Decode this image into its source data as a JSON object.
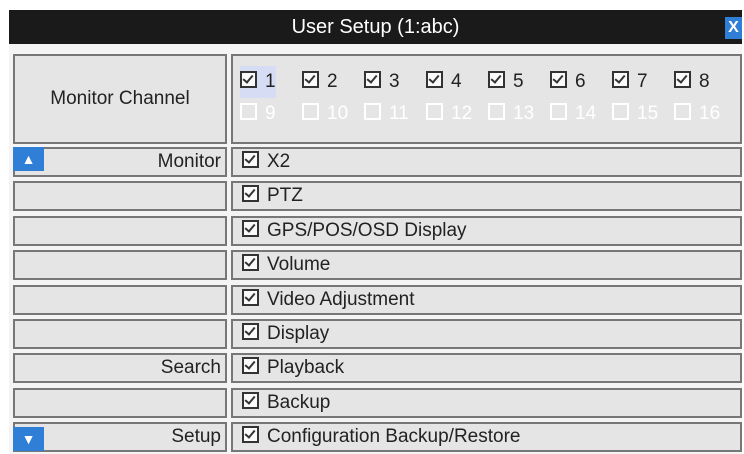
{
  "title": "User Setup (1:abc)",
  "close_glyph": "X",
  "monitor_channel_label": "Monitor Channel",
  "channels": [
    {
      "label": "1",
      "checked": true,
      "enabled": true
    },
    {
      "label": "2",
      "checked": true,
      "enabled": true
    },
    {
      "label": "3",
      "checked": true,
      "enabled": true
    },
    {
      "label": "4",
      "checked": true,
      "enabled": true
    },
    {
      "label": "5",
      "checked": true,
      "enabled": true
    },
    {
      "label": "6",
      "checked": true,
      "enabled": true
    },
    {
      "label": "7",
      "checked": true,
      "enabled": true
    },
    {
      "label": "8",
      "checked": true,
      "enabled": true
    },
    {
      "label": "9",
      "checked": false,
      "enabled": false
    },
    {
      "label": "10",
      "checked": false,
      "enabled": false
    },
    {
      "label": "11",
      "checked": false,
      "enabled": false
    },
    {
      "label": "12",
      "checked": false,
      "enabled": false
    },
    {
      "label": "13",
      "checked": false,
      "enabled": false
    },
    {
      "label": "14",
      "checked": false,
      "enabled": false
    },
    {
      "label": "15",
      "checked": false,
      "enabled": false
    },
    {
      "label": "16",
      "checked": false,
      "enabled": false
    }
  ],
  "rows": [
    {
      "category": "Monitor",
      "permission": "X2",
      "checked": true
    },
    {
      "category": "",
      "permission": "PTZ",
      "checked": true
    },
    {
      "category": "",
      "permission": "GPS/POS/OSD Display",
      "checked": true
    },
    {
      "category": "",
      "permission": "Volume",
      "checked": true
    },
    {
      "category": "",
      "permission": "Video Adjustment",
      "checked": true
    },
    {
      "category": "",
      "permission": "Display",
      "checked": true
    },
    {
      "category": "Search",
      "permission": "Playback",
      "checked": true
    },
    {
      "category": "",
      "permission": "Backup",
      "checked": true
    },
    {
      "category": "Setup",
      "permission": "Configuration Backup/Restore",
      "checked": true
    }
  ],
  "accent_color": "#2f7fd6"
}
